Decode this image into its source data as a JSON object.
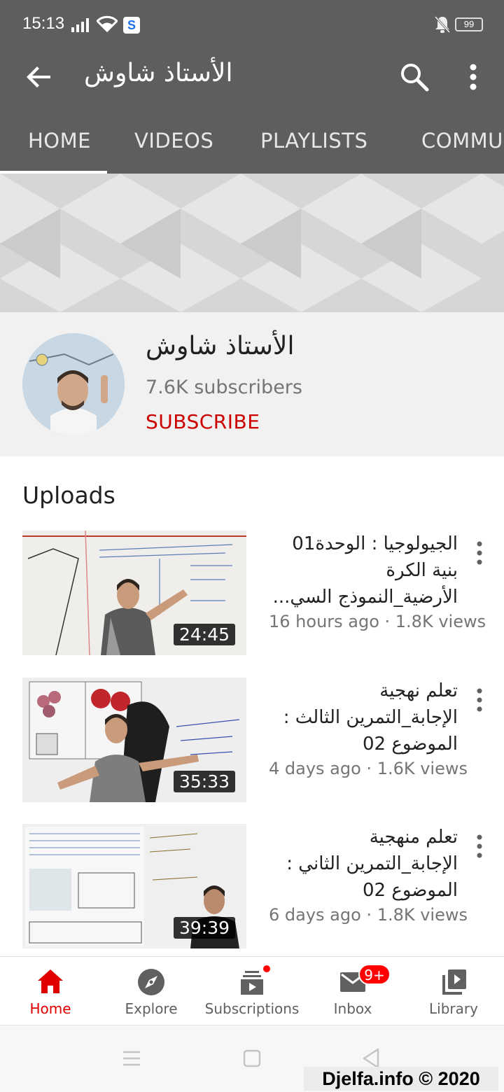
{
  "status_bar": {
    "time": "15:13",
    "battery": "99"
  },
  "app_bar": {
    "title": "الأستاذ شاوش"
  },
  "tabs": [
    {
      "label": "HOME",
      "active": true
    },
    {
      "label": "VIDEOS"
    },
    {
      "label": "PLAYLISTS"
    },
    {
      "label": "COMMUNITY"
    }
  ],
  "channel": {
    "name": "الأستاذ شاوش",
    "subscribers": "7.6K subscribers",
    "subscribe_label": "SUBSCRIBE"
  },
  "uploads": {
    "title": "Uploads",
    "videos": [
      {
        "title": "الجيولوجيا : الوحدة01 بنية الكرة الأرضية_النموذج السي...",
        "meta": "16 hours ago · 1.8K views",
        "duration": "24:45"
      },
      {
        "title": "تعلم نهجية الإجابة_التمرين الثالث : الموضوع 02",
        "meta": "4 days ago · 1.6K views",
        "duration": "35:33"
      },
      {
        "title": "تعلم منهجية الإجابة_التمرين الثاني : الموضوع 02",
        "meta": "6 days ago · 1.8K views",
        "duration": "39:39"
      }
    ]
  },
  "bottom_nav": {
    "items": [
      {
        "label": "Home",
        "icon": "home-icon",
        "active": true
      },
      {
        "label": "Explore",
        "icon": "compass-icon"
      },
      {
        "label": "Subscriptions",
        "icon": "subscriptions-icon"
      },
      {
        "label": "Inbox",
        "icon": "mail-icon",
        "badge": "9+"
      },
      {
        "label": "Library",
        "icon": "library-icon"
      }
    ]
  },
  "watermark": "Djelfa.info © 2020",
  "colors": {
    "app_bar": "#5e5e5e",
    "accent": "#cc0000",
    "active_nav": "#e00000"
  }
}
